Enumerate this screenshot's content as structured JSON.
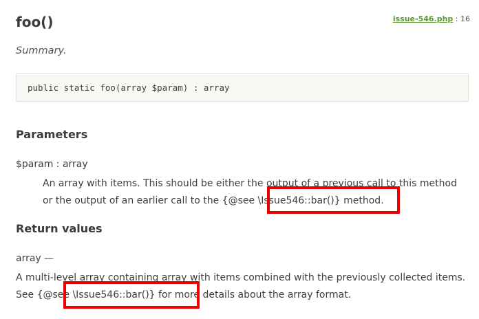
{
  "method": {
    "title": "foo()",
    "source_file": "issue-546.php",
    "source_separator": " : ",
    "source_line": "16",
    "summary": "Summary.",
    "signature": "public static foo(array $param) : array"
  },
  "parameters": {
    "heading": "Parameters",
    "items": [
      {
        "name_type": "$param : array",
        "desc_before": "An array with items. This should be either the output of a previous call to this method or the output of an earlier call to the ",
        "see_tag": "{@see \\Issue546::bar()}",
        "desc_after": " method."
      }
    ]
  },
  "return_values": {
    "heading": "Return values",
    "type": "array —",
    "desc_before": "A multi-level array containing array with items combined with the previously collected items. See ",
    "see_tag": "{@see \\Issue546::bar()}",
    "desc_after": " for more details about the array format."
  },
  "annotations": {
    "highlight_color": "#ee0000"
  }
}
